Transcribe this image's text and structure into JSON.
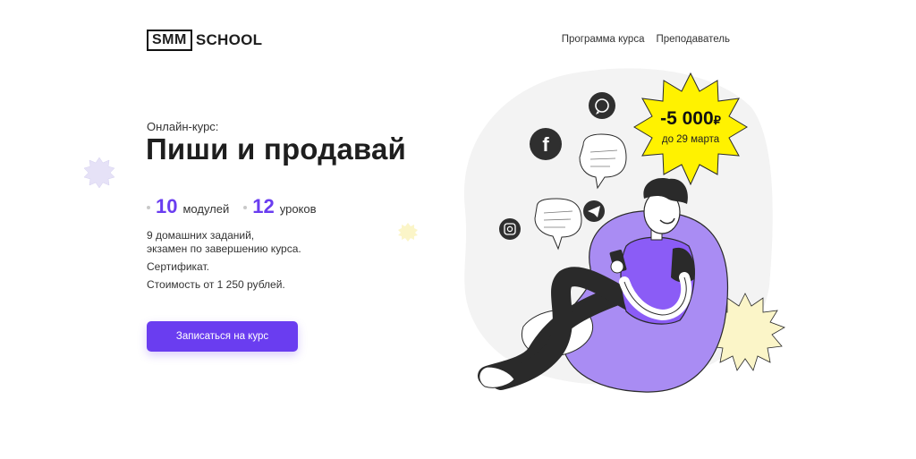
{
  "header": {
    "logo_box": "SMM",
    "logo_text": "SCHOOL",
    "nav": [
      {
        "label": "Программа курса"
      },
      {
        "label": "Преподаватель"
      }
    ]
  },
  "hero": {
    "eyebrow": "Онлайн-курс:",
    "title": "Пиши и продавай",
    "stats": [
      {
        "value": "10",
        "label": "модулей"
      },
      {
        "value": "12",
        "label": "уроков"
      }
    ],
    "description": [
      "9 домашних заданий,",
      "экзамен по завершению курса.",
      "Сертификат.",
      "Стоимость от 1 250 рублей."
    ],
    "cta_label": "Записаться на курс"
  },
  "badge": {
    "price": "-5 000",
    "currency": "₽",
    "date": "до 29 марта"
  },
  "colors": {
    "accent": "#6a3df0",
    "badge": "#fff200",
    "blob": "#f2f2f2",
    "star_pale": "#fbf5c8",
    "star_lilac": "#e6e2f7"
  },
  "icons": [
    "whatsapp-icon",
    "facebook-icon",
    "telegram-icon",
    "instagram-icon",
    "chat-bubble-icon"
  ]
}
